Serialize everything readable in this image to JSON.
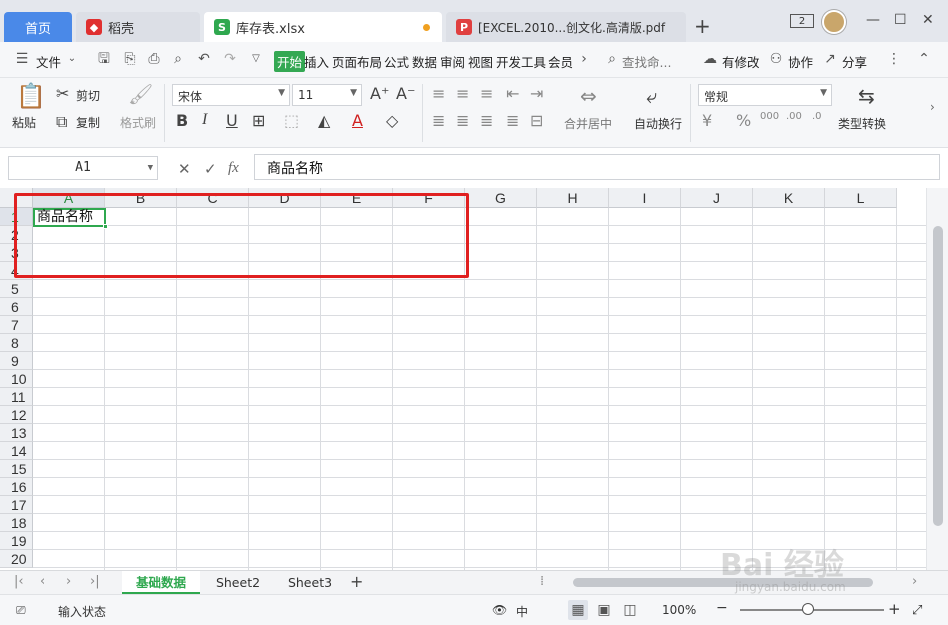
{
  "tabs": {
    "home": "首页",
    "daoke": "稻壳",
    "active_file": "库存表.xlsx",
    "pdf_file": "[EXCEL.2010...创文化.高清版.pdf",
    "window_badge": "2"
  },
  "menu": {
    "file": "文件",
    "items": [
      "开始",
      "插入",
      "页面布局",
      "公式",
      "数据",
      "审阅",
      "视图",
      "开发工具",
      "会员"
    ],
    "search": "查找命...",
    "modify": "有修改",
    "collab": "协作",
    "share": "分享"
  },
  "ribbon": {
    "paste": "粘贴",
    "cut": "剪切",
    "copy": "复制",
    "format_painter": "格式刷",
    "font_name": "宋体",
    "font_size": "11",
    "merge_center": "合并居中",
    "wrap_text": "自动换行",
    "number_format": "常规",
    "type_convert": "类型转换"
  },
  "formula_bar": {
    "cell_ref": "A1",
    "fx": "fx",
    "content": "商品名称"
  },
  "columns": [
    "A",
    "B",
    "C",
    "D",
    "E",
    "F",
    "G",
    "H",
    "I",
    "J",
    "K",
    "L"
  ],
  "rows": [
    "1",
    "2",
    "3",
    "4",
    "5",
    "6",
    "7",
    "8",
    "9",
    "10",
    "11",
    "12",
    "13",
    "14",
    "15",
    "16",
    "17",
    "18",
    "19",
    "20"
  ],
  "cells": {
    "A1": "商品名称"
  },
  "sheets": [
    "基础数据",
    "Sheet2",
    "Sheet3"
  ],
  "status": {
    "mode": "输入状态",
    "zoom": "100%"
  },
  "watermark": {
    "main": "Bai 经验",
    "sub": "jingyan.baidu.com"
  },
  "colors": {
    "accent_green": "#2fa84f",
    "home_tab": "#4a89e8",
    "highlight_box": "#e02020"
  }
}
